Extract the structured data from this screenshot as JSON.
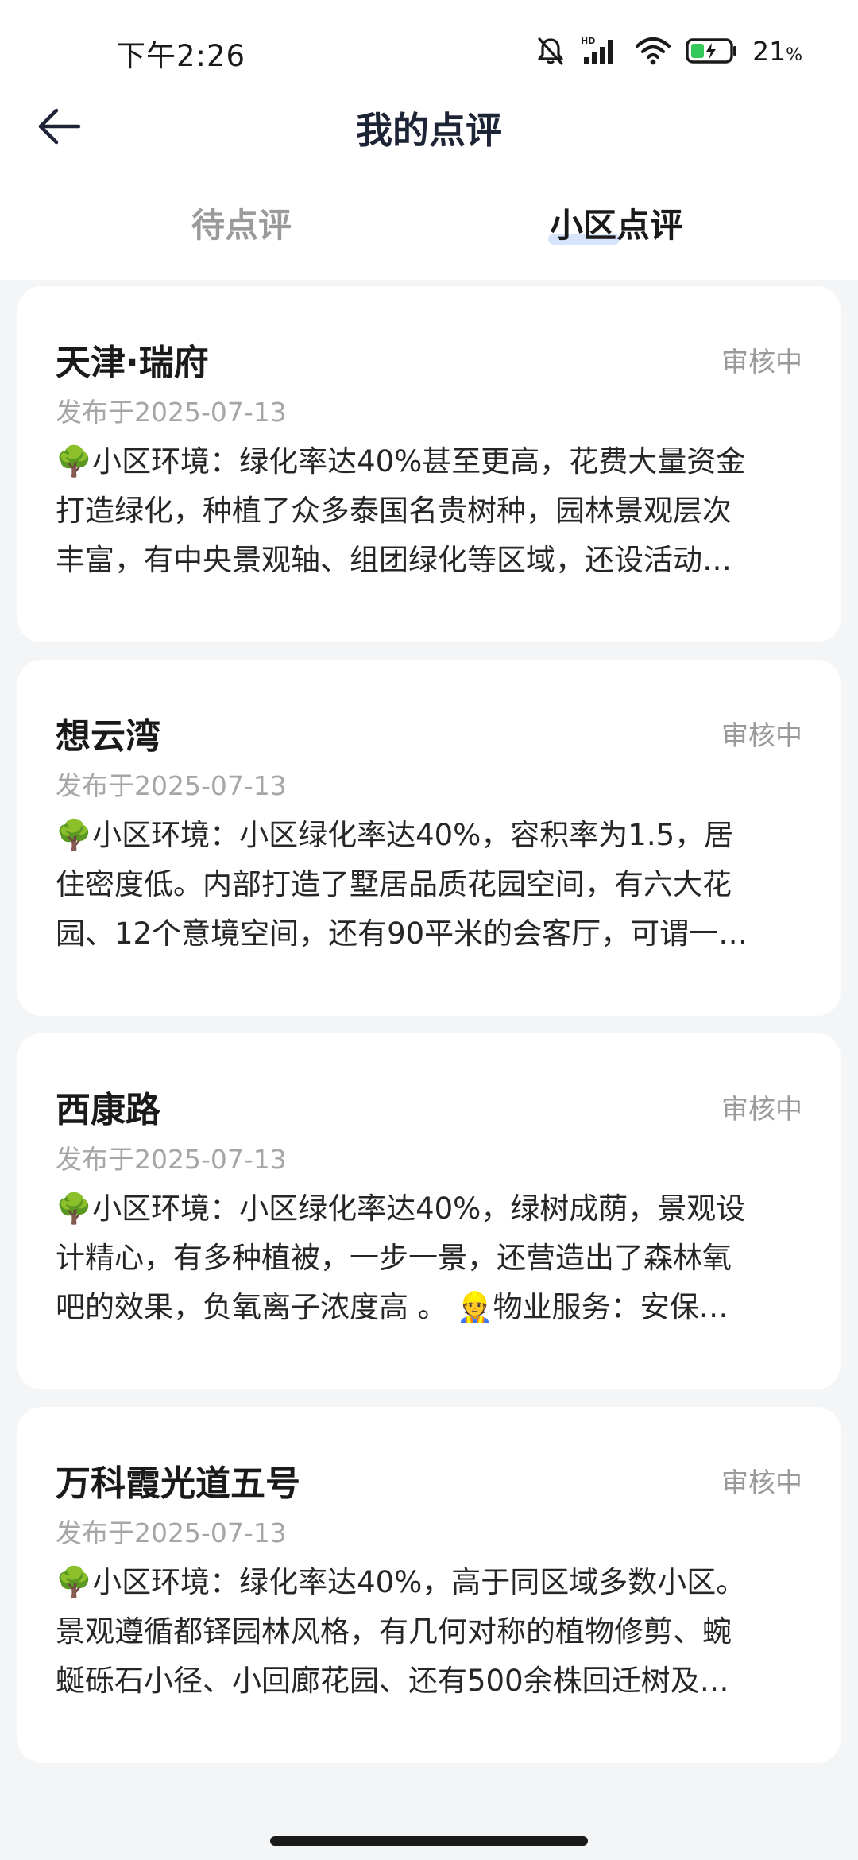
{
  "status_bar": {
    "time": "下午2:26",
    "battery_percent": "21",
    "battery_unit": "%",
    "icons": [
      "bell-muted-icon",
      "hd-signal-icon",
      "wifi-icon",
      "battery-charging-icon"
    ]
  },
  "nav": {
    "title": "我的点评",
    "back_icon": "back-arrow-icon"
  },
  "tabs": [
    {
      "label": "待点评",
      "active": false
    },
    {
      "label": "小区点评",
      "active": true
    }
  ],
  "reviews": [
    {
      "title": "天津·瑞府",
      "status": "审核中",
      "date": "发布于2025-07-13",
      "lines": [
        "🌳小区环境：绿化率达40%甚至更高，花费大量资金",
        "打造绿化，种植了众多泰国名贵树种，园林景观层次",
        "丰富，有中央景观轴、组团绿化等区域，还设活动…"
      ]
    },
    {
      "title": "想云湾",
      "status": "审核中",
      "date": "发布于2025-07-13",
      "lines": [
        "🌳小区环境：小区绿化率达40%，容积率为1.5，居",
        "住密度低。内部打造了墅居品质花园空间，有六大花",
        "园、12个意境空间，还有90平米的会客厅，可谓一…"
      ]
    },
    {
      "title": "西康路",
      "status": "审核中",
      "date": "发布于2025-07-13",
      "lines": [
        "🌳小区环境：小区绿化率达40%，绿树成荫，景观设",
        "计精心，有多种植被，一步一景，还营造出了森林氧",
        "吧的效果，负氧离子浓度高 。 👷物业服务：安保…"
      ]
    },
    {
      "title": "万科霞光道五号",
      "status": "审核中",
      "date": "发布于2025-07-13",
      "lines": [
        "🌳小区环境：绿化率达40%，高于同区域多数小区。",
        "景观遵循都铎园林风格，有几何对称的植物修剪、蜿",
        "蜒砾石小径、小回廊花园、还有500余株回迁树及…"
      ]
    }
  ]
}
